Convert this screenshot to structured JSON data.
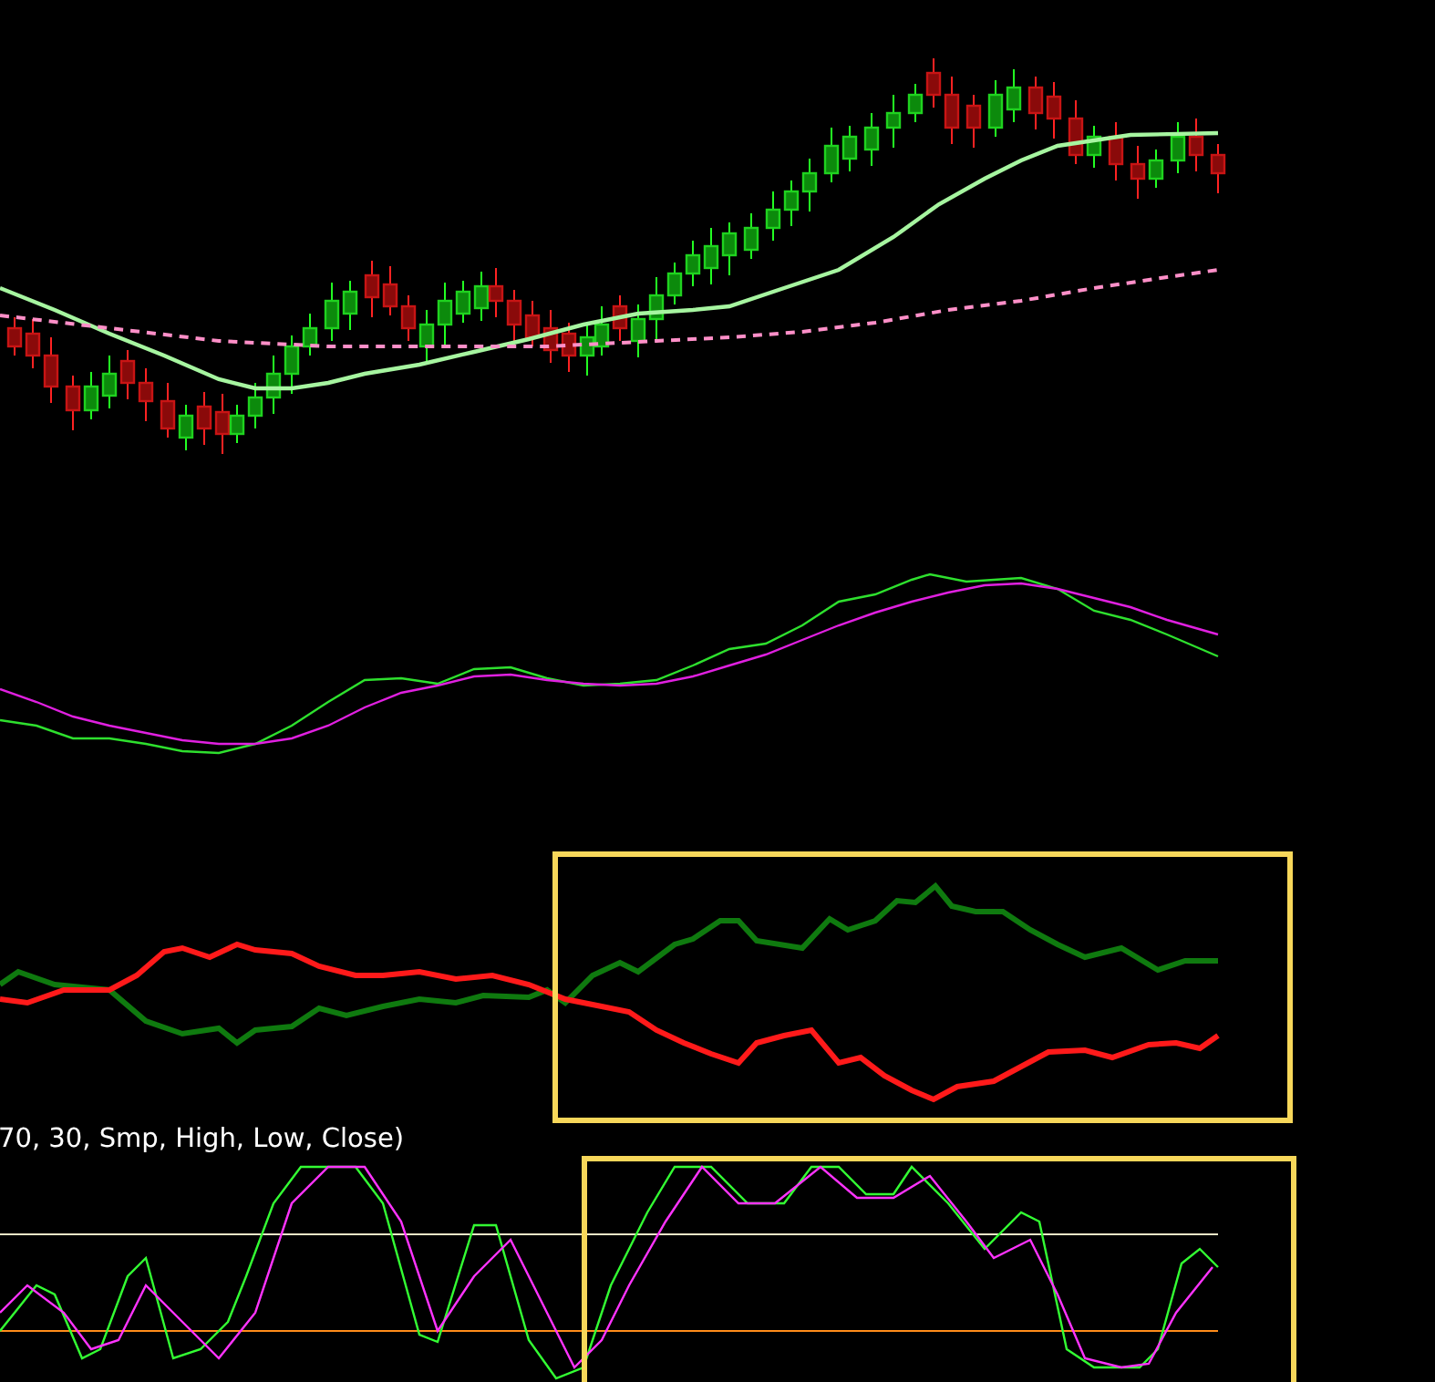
{
  "indicator_legend": "70, 30, Smp, High, Low, Close)"
}
